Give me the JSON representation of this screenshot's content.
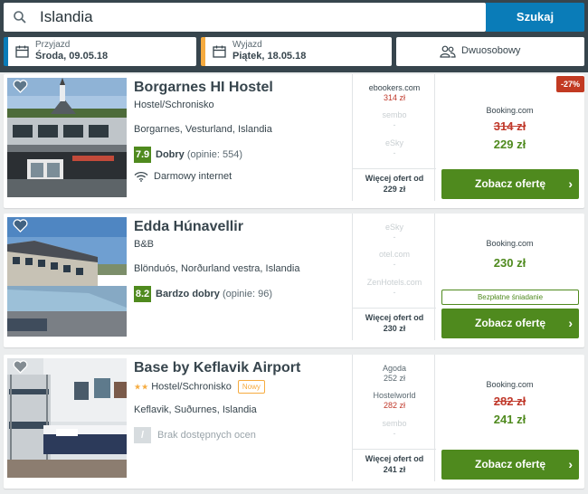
{
  "search": {
    "query": "Islandia",
    "button_label": "Szukaj"
  },
  "dates": {
    "checkin_label": "Przyjazd",
    "checkin_value": "Środa, 09.05.18",
    "checkout_label": "Wyjazd",
    "checkout_value": "Piątek, 18.05.18",
    "room_label": "Dwuosobowy"
  },
  "colors": {
    "brand_blue": "#0a7cb8",
    "deal_green": "#4f8a1e",
    "price_red": "#c0392b",
    "header": "#37454d",
    "accent_orange": "#f6ab3f"
  },
  "hotels": [
    {
      "name": "Borgarnes HI Hostel",
      "type": "Hostel/Schronisko",
      "location": "Borgarnes, Vesturland, Islandia",
      "rating_score": "7.9",
      "rating_word": "Dobry",
      "rating_count": "(opinie: 554)",
      "amenity": "Darmowy internet",
      "amenity_icon": "wifi-icon",
      "deals": [
        {
          "site": "ebookers.com",
          "price": "314 zł"
        },
        {
          "site": "sembo",
          "price": "-"
        },
        {
          "site": "eSky",
          "price": "-"
        }
      ],
      "more_label": "Więcej ofert od",
      "more_price": "229 zł",
      "best_site": "Booking.com",
      "old_price": "314 zł",
      "new_price": "229 zł",
      "discount": "-27%",
      "cta": "Zobacz ofertę"
    },
    {
      "name": "Edda Húnavellir",
      "type": "B&B",
      "location": "Blönduós, Norðurland vestra, Islandia",
      "rating_score": "8.2",
      "rating_word": "Bardzo dobry",
      "rating_count": "(opinie: 96)",
      "deals": [
        {
          "site": "eSky",
          "price": "-"
        },
        {
          "site": "otel.com",
          "price": "-"
        },
        {
          "site": "ZenHotels.com",
          "price": "-"
        }
      ],
      "more_label": "Więcej ofert od",
      "more_price": "230 zł",
      "best_site": "Booking.com",
      "new_price": "230 zł",
      "perk": "Bezpłatne śniadanie",
      "cta": "Zobacz ofertę"
    },
    {
      "name": "Base by Keflavik Airport",
      "stars": "★★",
      "type": "Hostel/Schronisko",
      "new_tag": "Nowy",
      "location": "Keflavik, Suðurnes, Islandia",
      "rating_score": "/",
      "rating_none": "Brak dostępnych ocen",
      "deals": [
        {
          "site": "Agoda",
          "price": "252 zł"
        },
        {
          "site": "Hostelworld",
          "price": "282 zł"
        },
        {
          "site": "sembo",
          "price": "-"
        }
      ],
      "more_label": "Więcej ofert od",
      "more_price": "241 zł",
      "best_site": "Booking.com",
      "old_price": "282 zł",
      "new_price": "241 zł",
      "cta": "Zobacz ofertę"
    }
  ]
}
